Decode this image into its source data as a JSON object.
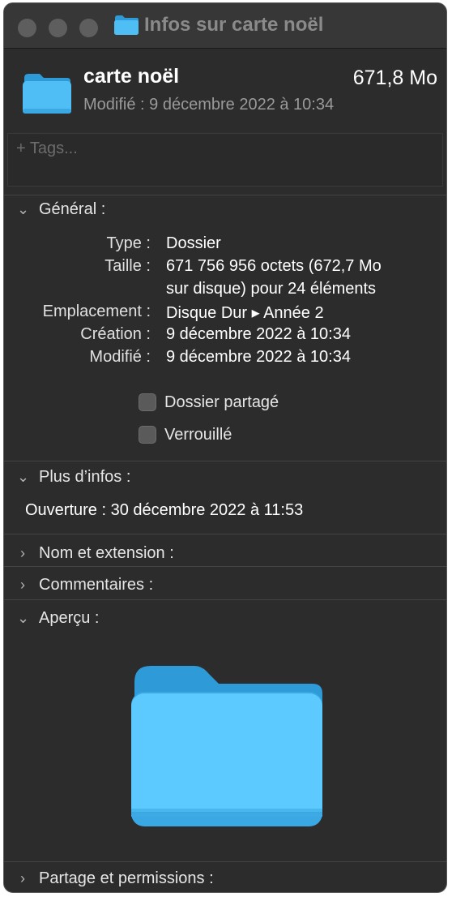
{
  "window": {
    "title": "Infos sur carte noël",
    "folder_icon": "folder-icon"
  },
  "header": {
    "name": "carte noël",
    "size": "671,8 Mo",
    "modified_label": "Modifié :",
    "modified_value": "9 décembre 2022 à 10:34"
  },
  "tags": {
    "placeholder": "+ Tags..."
  },
  "general": {
    "title": "Général :",
    "rows": [
      {
        "label": "Type :",
        "value": "Dossier"
      },
      {
        "label": "Taille :",
        "value": "671 756 956 octets (672,7 Mo",
        "value_line2": "sur disque) pour 24 éléments"
      },
      {
        "label": "Emplacement :",
        "value": "Disque Dur ▸ Année 2"
      },
      {
        "label": "Création :",
        "value": "9 décembre 2022 à 10:34"
      },
      {
        "label": "Modifié :",
        "value": "9 décembre 2022 à 10:34"
      }
    ],
    "shared_folder_label": "Dossier partagé",
    "shared_folder_checked": false,
    "locked_label": "Verrouillé",
    "locked_checked": false
  },
  "more_info": {
    "title": "Plus d’infos :",
    "opened_label": "Ouverture :",
    "opened_value": "30 décembre 2022 à 11:53"
  },
  "name_extension": {
    "title": "Nom et extension :"
  },
  "comments": {
    "title": "Commentaires :"
  },
  "preview": {
    "title": "Aperçu :"
  },
  "sharing": {
    "title": "Partage et permissions :"
  },
  "colors": {
    "window_bg": "#2c2c2c",
    "folder_blue": "#4fbef5"
  }
}
